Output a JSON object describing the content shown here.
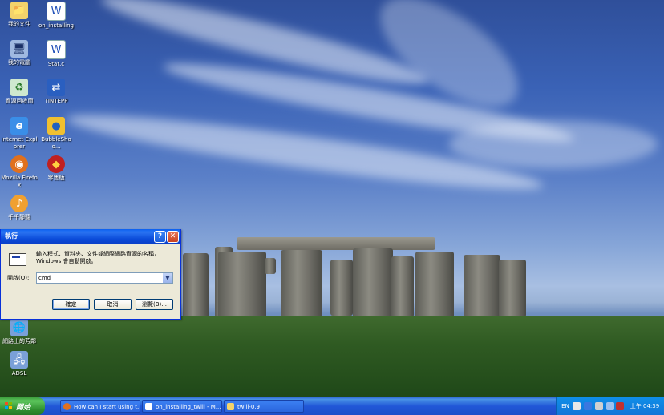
{
  "desktop": {
    "icons": [
      {
        "label": "我的文件"
      },
      {
        "label": "on_installing"
      },
      {
        "label": "我的電腦"
      },
      {
        "label": "Stat.c"
      },
      {
        "label": "資源回收筒"
      },
      {
        "label": "TINTEPP"
      },
      {
        "label": "Internet Explorer"
      },
      {
        "label": "BubbleShoo..."
      },
      {
        "label": "Mozilla Firefox"
      },
      {
        "label": "零售版"
      },
      {
        "label": "千千靜聽"
      },
      {
        "label": "網路上的芳鄰"
      },
      {
        "label": "ADSL"
      }
    ]
  },
  "run_dialog": {
    "title": "執行",
    "help_glyph": "?",
    "close_glyph": "✕",
    "description": "輸入程式、資料夾、文件或網際網路資源的名稱，Windows 會自動開啟。",
    "open_label": "開啟(O):",
    "open_value": "cmd",
    "ok_label": "確定",
    "cancel_label": "取消",
    "browse_label": "瀏覽(B)..."
  },
  "taskbar": {
    "start_label": "開始",
    "tasks": [
      {
        "label": "How can I start using t..."
      },
      {
        "label": "on_installing_twill - M..."
      },
      {
        "label": "twill-0.9"
      }
    ],
    "tray": {
      "language": "EN",
      "clock": "上午 04:39"
    }
  }
}
